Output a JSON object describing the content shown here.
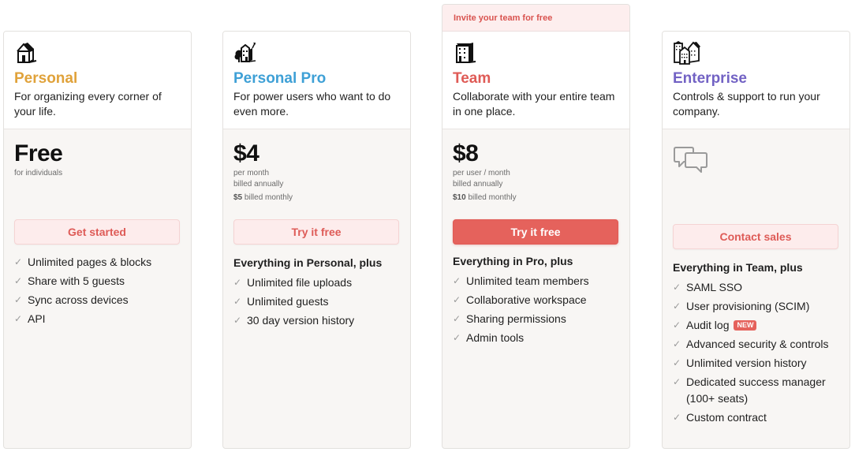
{
  "colors": {
    "personal": "#e0a23a",
    "personal_pro": "#3ea0d6",
    "team": "#df5b56",
    "enterprise": "#7262c4",
    "accent": "#e5625c"
  },
  "plans": [
    {
      "icon": "house-icon",
      "name": "Personal",
      "description": "For organizing every corner of your life.",
      "price": "Free",
      "price_sub": "for individuals",
      "button_label": "Get started",
      "features": [
        "Unlimited pages & blocks",
        "Share with 5 guests",
        "Sync across devices",
        "API"
      ]
    },
    {
      "icon": "house-with-tree-icon",
      "name": "Personal Pro",
      "description": "For power users who want to do even more.",
      "price": "$4",
      "price_sub_1": "per month",
      "price_sub_2": "billed annually",
      "monthly_price": "$5",
      "monthly_label": "billed monthly",
      "button_label": "Try it free",
      "plus_title": "Everything in Personal, plus",
      "features": [
        "Unlimited file uploads",
        "Unlimited guests",
        "30 day version history"
      ]
    },
    {
      "banner": "Invite your team for free",
      "icon": "office-building-icon",
      "name": "Team",
      "description": "Collaborate with your entire team in one place.",
      "price": "$8",
      "price_sub_1": "per user / month",
      "price_sub_2": "billed annually",
      "monthly_price": "$10",
      "monthly_label": "billed monthly",
      "button_label": "Try it free",
      "plus_title": "Everything in Pro, plus",
      "features": [
        "Unlimited team members",
        "Collaborative workspace",
        "Sharing permissions",
        "Admin tools"
      ]
    },
    {
      "icon": "city-buildings-icon",
      "name": "Enterprise",
      "description": "Controls & support to run your company.",
      "price_icon": "chat-bubbles-icon",
      "button_label": "Contact sales",
      "plus_title": "Everything in Team, plus",
      "features": [
        "SAML SSO",
        "User provisioning (SCIM)",
        "Audit log",
        "Advanced security & controls",
        "Unlimited version history",
        "Dedicated success manager (100+ seats)",
        "Custom contract"
      ],
      "new_badge": "NEW"
    }
  ]
}
